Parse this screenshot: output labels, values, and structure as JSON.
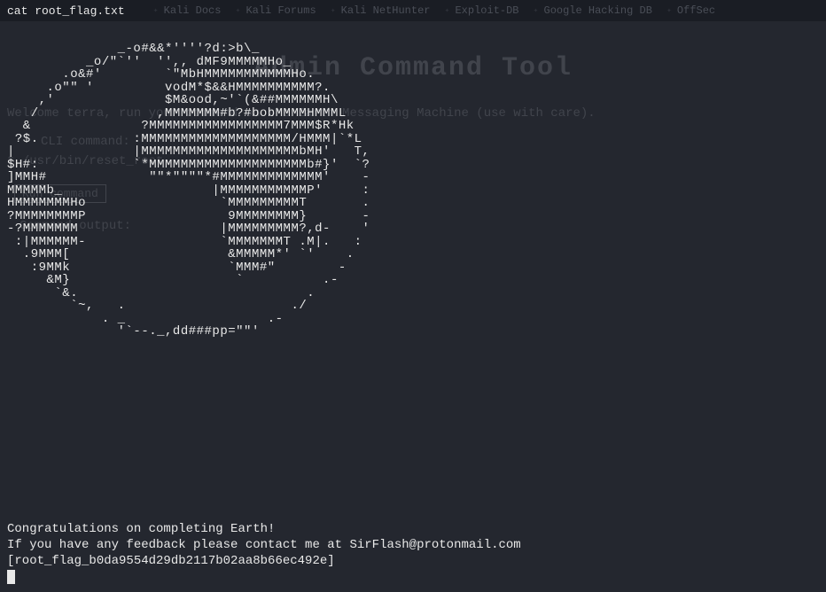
{
  "top_command": "cat root_flag.txt",
  "bookmarks": {
    "items": [
      "Kali Docs",
      "Kali Forums",
      "Kali NetHunter",
      "Exploit-DB",
      "Google Hacking DB",
      "OffSec"
    ]
  },
  "page": {
    "title": "Admin Command Tool",
    "welcome": "Welcome terra, run your command on the Earth Messaging Machine (use with care).",
    "cli_label": "CLI command:",
    "cli_value": "t /usr/bin/reset_root",
    "run_button": "Run command",
    "output_label": "Command output:"
  },
  "ascii_art": "              _-o#&&*''''?d:>b\\_\n          _o/\"`''  '',, dMF9MMMMMHo_\n       .o&#'        `\"MbHMMMMMMMMMMMHo.\n     .o\"\" '         vodM*$&&HMMMMMMMMMM?.\n    ,'              $M&ood,~'`(&##MMMMMMH\\\n   /               ,MMMMMMM#b?#bobMMMMHMMML\n  &              ?MMMMMMMMMMMMMMMMM7MMM$R*Hk\n ?$.            :MMMMMMMMMMMMMMMMMMM/HMMM|`*L\n|               |MMMMMMMMMMMMMMMMMMMMbMH'   T,\n$H#:            `*MMMMMMMMMMMMMMMMMMMMb#}'  `?\n]MMH#             \"\"*\"\"\"\"*#MMMMMMMMMMMMM'    -\nMMMMMb_                   |MMMMMMMMMMMP'     :\nHMMMMMMMHo                 `MMMMMMMMMT       .\n?MMMMMMMMP                  9MMMMMMMM}       -\n-?MMMMMMM                  |MMMMMMMMM?,d-    '\n :|MMMMMM-                 `MMMMMMMT .M|.   :\n  .9MMM[                    &MMMMM*' `'    .\n   :9MMk                    `MMM#\"        -\n     &M}                     `          .-\n      `&.                             .\n        `~,   .                     ./\n            . _                  .-\n              '`--._,dd###pp=\"\"'",
  "footer": {
    "line1": "Congratulations on completing Earth!",
    "line2": "If you have any feedback please contact me at SirFlash@protonmail.com",
    "line3": "[root_flag_b0da9554d29db2117b02aa8b66ec492e]"
  }
}
